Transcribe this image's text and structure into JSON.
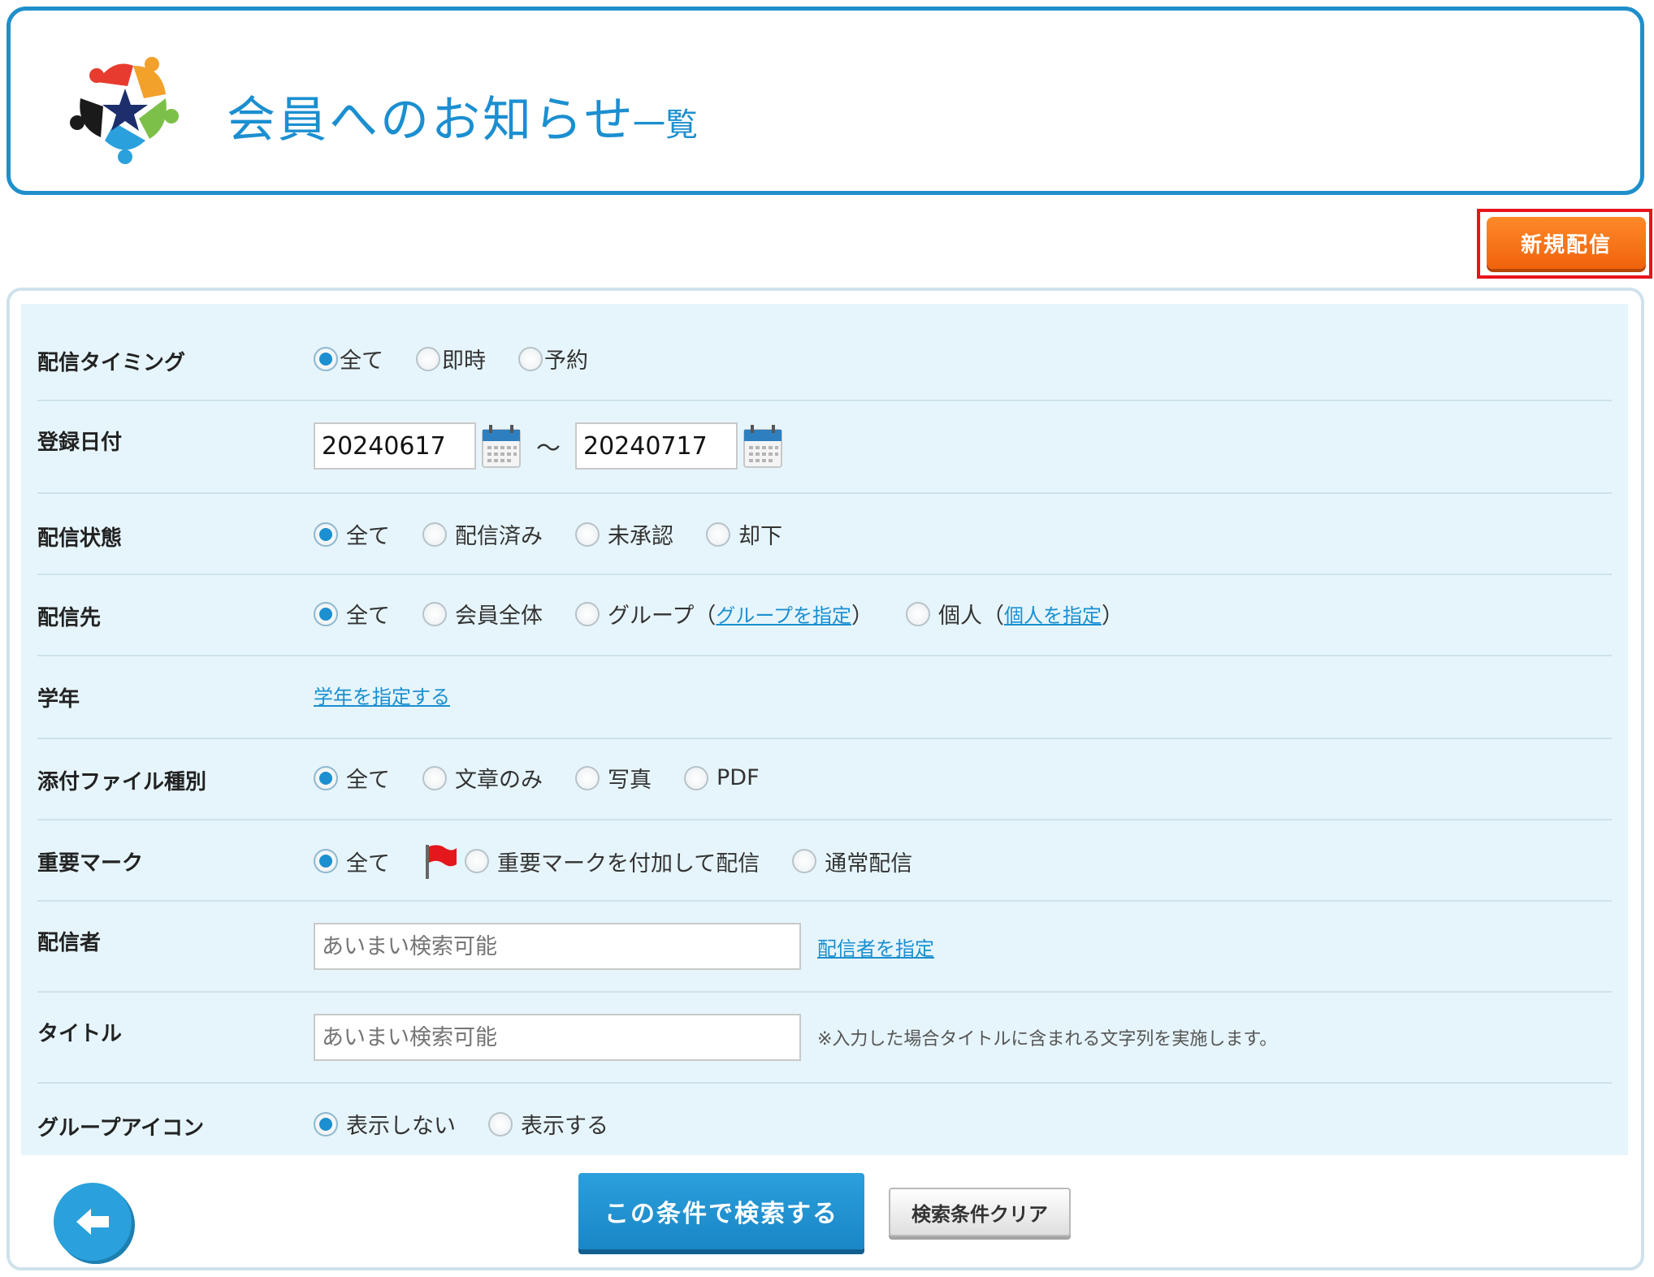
{
  "header": {
    "title": "会員へのお知らせ",
    "subtitle": "一覧"
  },
  "new_button_label": "新規配信",
  "colors": {
    "accent": "#1b8fd0",
    "orange": "#f0620c",
    "panel_bg": "#e6f5fb",
    "highlight": "#e8141c"
  },
  "filters": {
    "timing": {
      "label": "配信タイミング",
      "options": [
        "全て",
        "即時",
        "予約"
      ],
      "selected": "全て"
    },
    "reg_date": {
      "label": "登録日付",
      "from": "20240617",
      "separator": "～",
      "to": "20240717"
    },
    "status": {
      "label": "配信状態",
      "options": [
        "全て",
        "配信済み",
        "未承認",
        "却下"
      ],
      "selected": "全て"
    },
    "target": {
      "label": "配信先",
      "opt_all": "全て",
      "opt_members": "会員全体",
      "opt_group": "グループ",
      "group_link": "グループを指定",
      "opt_person": "個人",
      "person_link": "個人を指定",
      "paren_open": "（",
      "paren_close": "）",
      "selected": "全て"
    },
    "grade": {
      "label": "学年",
      "link": "学年を指定する"
    },
    "attachment": {
      "label": "添付ファイル種別",
      "options": [
        "全て",
        "文章のみ",
        "写真",
        "PDF"
      ],
      "selected": "全て"
    },
    "important": {
      "label": "重要マーク",
      "opt_all": "全て",
      "opt_important": "重要マークを付加して配信",
      "opt_normal": "通常配信",
      "selected": "全て"
    },
    "sender": {
      "label": "配信者",
      "placeholder": "あいまい検索可能",
      "link": "配信者を指定"
    },
    "title": {
      "label": "タイトル",
      "placeholder": "あいまい検索可能",
      "note": "※入力した場合タイトルに含まれる文字列を実施します。"
    },
    "group_icon": {
      "label": "グループアイコン",
      "options": [
        "表示しない",
        "表示する"
      ],
      "selected": "表示しない"
    }
  },
  "buttons": {
    "search": "この条件で検索する",
    "clear": "検索条件クリア"
  },
  "icons": {
    "logo": "star-people-logo",
    "calendar": "calendar-icon",
    "flag": "red-flag-icon",
    "back": "back-arrow-icon"
  }
}
